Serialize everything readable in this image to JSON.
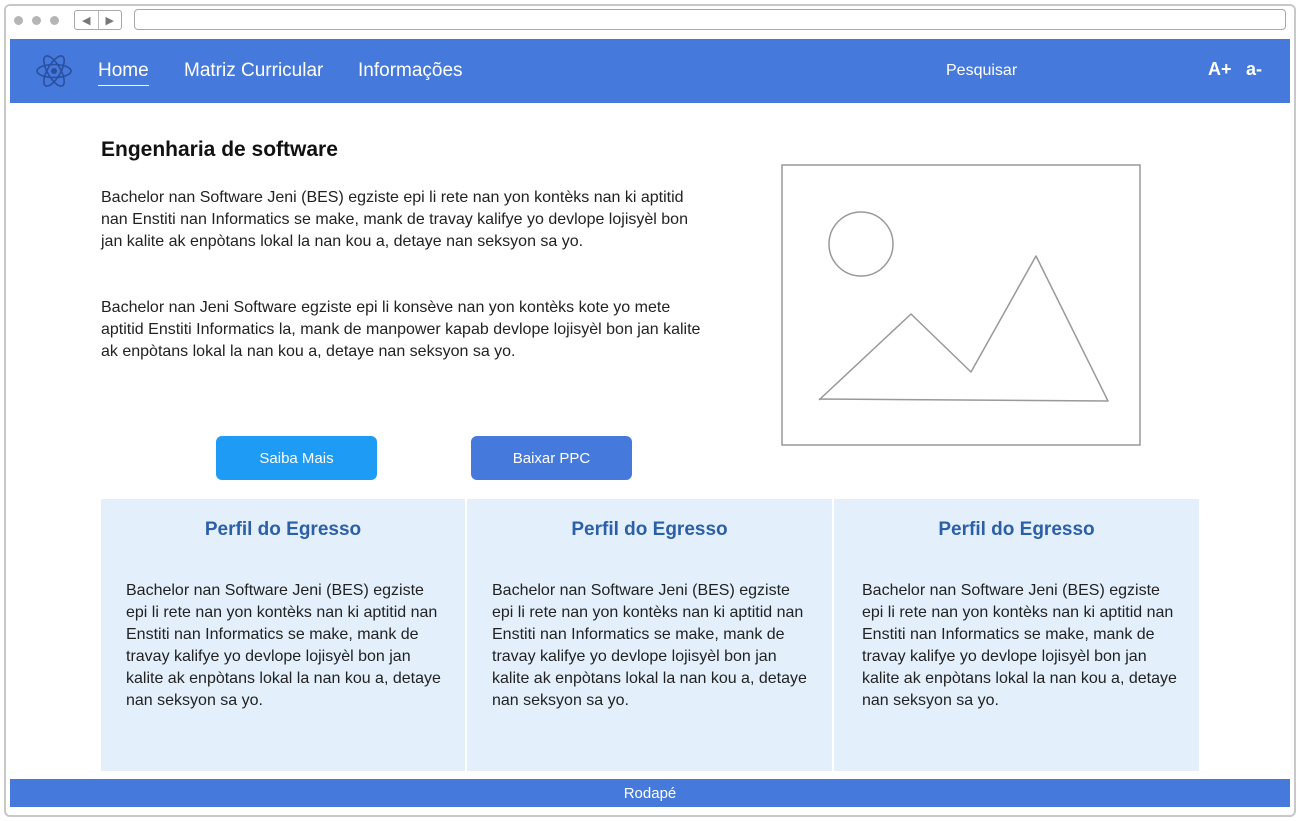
{
  "header": {
    "nav": [
      {
        "label": "Home",
        "active": true
      },
      {
        "label": "Matriz Curricular",
        "active": false
      },
      {
        "label": "Informações",
        "active": false
      }
    ],
    "search_label": "Pesquisar",
    "font_increase": "A+",
    "font_decrease": "a-",
    "logo_icon": "atom-icon",
    "color": "#4579db"
  },
  "main": {
    "title": "Engenharia de software",
    "paragraphs": [
      "Bachelor nan Software Jeni (BES) egziste epi li rete nan yon kontèks nan ki aptitid nan Enstiti nan Informatics se make, mank de travay kalifye yo devlope lojisyèl bon jan kalite ak enpòtans lokal la nan kou a, detaye nan seksyon sa yo.",
      "Bachelor nan Jeni Software egziste epi li konsève nan yon kontèks kote yo mete aptitid Enstiti Informatics la, mank de manpower kapab devlope lojisyèl bon jan kalite ak enpòtans lokal la nan kou a, detaye nan seksyon sa yo."
    ],
    "image_icon": "image-placeholder-icon",
    "buttons": {
      "learn_more": "Saiba Mais",
      "download": "Baixar PPC"
    }
  },
  "cards": [
    {
      "title": "Perfil do Egresso",
      "text": "Bachelor nan Software Jeni (BES) egziste epi li rete nan yon kontèks nan ki aptitid nan Enstiti nan Informatics se make, mank de travay kalifye yo devlope lojisyèl bon jan kalite ak enpòtans lokal la nan kou a, detaye nan seksyon sa yo."
    },
    {
      "title": "Perfil do Egresso",
      "text": "Bachelor nan Software Jeni (BES) egziste epi li rete nan yon kontèks nan ki aptitid nan Enstiti nan Informatics se make, mank de travay kalifye yo devlope lojisyèl bon jan kalite ak enpòtans lokal la nan kou a, detaye nan seksyon sa yo."
    },
    {
      "title": "Perfil do Egresso",
      "text": "Bachelor nan Software Jeni (BES) egziste epi li rete nan yon kontèks nan ki aptitid nan Enstiti nan Informatics se make, mank de travay kalifye yo devlope lojisyèl bon jan kalite ak enpòtans lokal la nan kou a, detaye nan seksyon sa yo."
    }
  ],
  "footer": {
    "label": "Rodapé"
  }
}
